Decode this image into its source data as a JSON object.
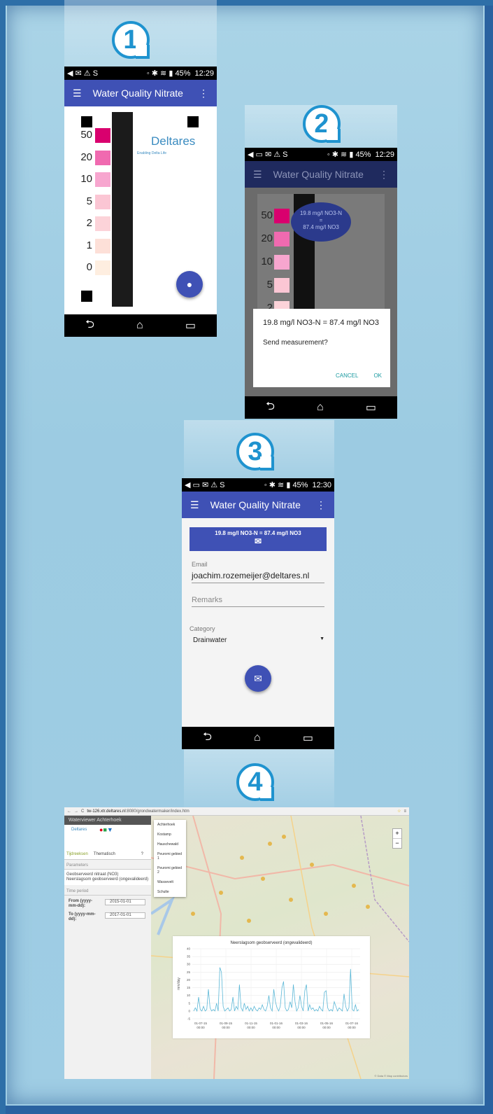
{
  "steps": [
    "1",
    "2",
    "3",
    "4"
  ],
  "status": {
    "battery": "45%",
    "time1": "12:29",
    "time2": "12:29",
    "time3": "12:30"
  },
  "app": {
    "title": "Water Quality Nitrate"
  },
  "screen1": {
    "scale": [
      "50",
      "20",
      "10",
      "5",
      "2",
      "1",
      "0"
    ],
    "swatch_colors": [
      "#d9006e",
      "#f06ab0",
      "#f7a6cf",
      "#fbc6d4",
      "#fcd3d9",
      "#fde0d8",
      "#feeee0"
    ],
    "logo": "Deltares",
    "tagline": "Enabling Delta Life"
  },
  "screen2": {
    "bubble_line1": "19.8 mg/l NO3-N",
    "bubble_line2": "=",
    "bubble_line3": "87.4 mg/l NO3",
    "dialog_text": "19.8 mg/l NO3-N = 87.4 mg/l NO3",
    "dialog_question": "Send measurement?",
    "cancel": "CANCEL",
    "ok": "OK"
  },
  "screen3": {
    "result": "19.8 mg/l NO3-N = 87.4 mg/l NO3",
    "email_label": "Email",
    "email_value": "joachim.rozemeijer@deltares.nl",
    "remarks_placeholder": "Remarks",
    "category_label": "Category",
    "category_value": "Drainwater"
  },
  "web": {
    "url_host": "tw-126.xtr.deltares.nl",
    "url_path": ":8080/grondwatermaker/index.htm",
    "app_title": "Waterviewer Achterhoek",
    "tab1": "Tijdreeksen",
    "tab2": "Thematisch",
    "help": "?",
    "params_header": "Parameters",
    "param1": "Geobserveerd nitraat (NO3)",
    "param2": "Neerslagsom geobserveerd (ongevalideerd)",
    "time_header": "Time period",
    "from_label": "From (yyyy-mm-dd):",
    "from_value": "2015-01-01",
    "to_label": "To (yyyy-mm-dd):",
    "to_value": "2017-01-01",
    "menu": [
      "Achterhoek",
      "Kostamp",
      "Hauschewald",
      "Peuromi gebied 1",
      "Peuromi gebied 2",
      "Wassevelt",
      "Schulte"
    ],
    "zoom_in": "+",
    "zoom_out": "−",
    "attribution": "© Data © Map contributors"
  },
  "chart_data": {
    "type": "line",
    "title": "Neerslagsom geobserveerd (ongevalideerd)",
    "ylabel": "mm/day",
    "ylim": [
      -5,
      40
    ],
    "yticks": [
      "40",
      "35",
      "30",
      "25",
      "20",
      "15",
      "10",
      "5",
      "0",
      "-5"
    ],
    "xticks": [
      "01-07-15 00:00",
      "01-09-15 00:00",
      "01-11-15 00:00",
      "01-01-16 00:00",
      "01-03-16 00:00",
      "01-05-16 00:00",
      "01-07-16 00:00"
    ],
    "series": [
      {
        "values": [
          0,
          2,
          0,
          9,
          1,
          0,
          3,
          0,
          1,
          14,
          2,
          0,
          1,
          0,
          5,
          0,
          28,
          25,
          3,
          0,
          1,
          2,
          0,
          1,
          9,
          0,
          3,
          1,
          17,
          2,
          0,
          5,
          1,
          3,
          0,
          2,
          0,
          3,
          1,
          0,
          2,
          1,
          4,
          1,
          0,
          3,
          10,
          2,
          0,
          14,
          6,
          2,
          0,
          3,
          15,
          19,
          2,
          0,
          1,
          6,
          2,
          17,
          6,
          0,
          2,
          10,
          3,
          0,
          13,
          17,
          0,
          4,
          1,
          2,
          0,
          1,
          0,
          3,
          1,
          0,
          12,
          13,
          2,
          0,
          1,
          0,
          6,
          3,
          0,
          2,
          1,
          0,
          11,
          3,
          0,
          2,
          27,
          1,
          0,
          4,
          0,
          1
        ]
      }
    ],
    "color": "#5bb7d6"
  }
}
